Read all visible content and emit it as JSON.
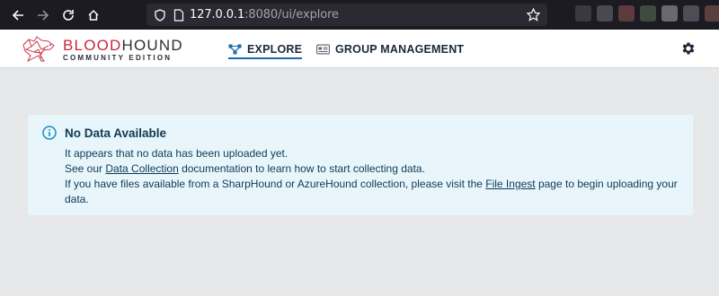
{
  "browser": {
    "url_host": "127.0.0.1",
    "url_rest": ":8080/ui/explore"
  },
  "app": {
    "logo_title_red": "BLOOD",
    "logo_title_dark": "HOUND",
    "logo_subtitle": "COMMUNITY EDITION"
  },
  "nav": {
    "tabs": [
      {
        "label": "EXPLORE",
        "icon": "graph-icon",
        "active": true
      },
      {
        "label": "GROUP MANAGEMENT",
        "icon": "group-card-icon",
        "active": false
      }
    ]
  },
  "alert": {
    "title": "No Data Available",
    "line1": "It appears that no data has been uploaded yet.",
    "line2_before": "See our ",
    "line2_link": "Data Collection",
    "line2_after": " documentation to learn how to start collecting data.",
    "line3_before": "If you have files available from a SharpHound or AzureHound collection, please visit the ",
    "line3_link": "File Ingest",
    "line3_after": " page to begin uploading your data."
  },
  "colors": {
    "brand_red": "#c7273d",
    "active_tab_underline": "#1a6ba7",
    "alert_bg": "#e8f6fc",
    "alert_icon": "#1b8ec4"
  }
}
